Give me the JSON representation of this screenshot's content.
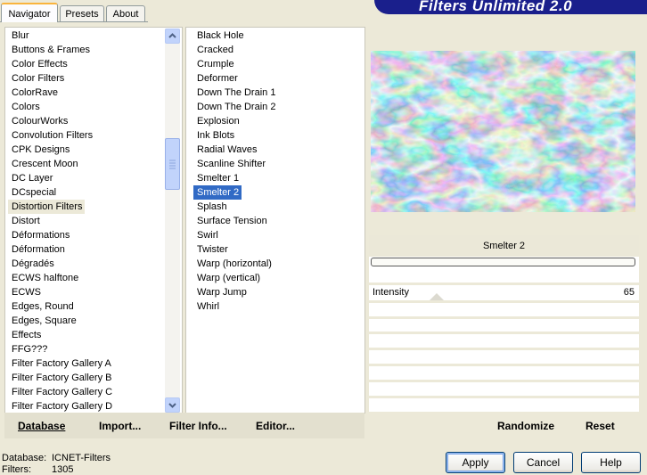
{
  "tabs": [
    "Navigator",
    "Presets",
    "About"
  ],
  "banner_title": "Filters Unlimited 2.0",
  "categories": [
    "Blur",
    "Buttons & Frames",
    "Color Effects",
    "Color Filters",
    "ColorRave",
    "Colors",
    "ColourWorks",
    "Convolution Filters",
    "CPK Designs",
    "Crescent Moon",
    "DC Layer",
    "DCspecial",
    "Distortion Filters",
    "Distort",
    "Déformations",
    "Déformation",
    "Dégradés",
    "ECWS halftone",
    "ECWS",
    "Edges, Round",
    "Edges, Square",
    "Effects",
    "FFG???",
    "Filter Factory Gallery A",
    "Filter Factory Gallery B",
    "Filter Factory Gallery C",
    "Filter Factory Gallery D"
  ],
  "selected_category": "Distortion Filters",
  "filters": [
    "Black Hole",
    "Cracked",
    "Crumple",
    "Deformer",
    "Down The Drain 1",
    "Down The Drain 2",
    "Explosion",
    "Ink Blots",
    "Radial Waves",
    "Scanline Shifter",
    "Smelter 1",
    "Smelter 2",
    "Splash",
    "Surface Tension",
    "Swirl",
    "Twister",
    "Warp (horizontal)",
    "Warp (vertical)",
    "Warp Jump",
    "Whirl"
  ],
  "selected_filter": "Smelter 2",
  "toolbar": {
    "database": "Database",
    "import": "Import...",
    "filter_info": "Filter Info...",
    "editor": "Editor..."
  },
  "filter_name": "Smelter 2",
  "parameter": {
    "label": "Intensity",
    "value": "65"
  },
  "actions": {
    "randomize": "Randomize",
    "reset": "Reset"
  },
  "status": {
    "database_label": "Database:",
    "database_value": "ICNET-Filters",
    "filters_label": "Filters:",
    "filters_value": "1305"
  },
  "buttons": {
    "apply": "Apply",
    "cancel": "Cancel",
    "help": "Help"
  },
  "icons": {
    "scroll_up": "chevron-up-icon",
    "scroll_down": "chevron-down-icon"
  }
}
